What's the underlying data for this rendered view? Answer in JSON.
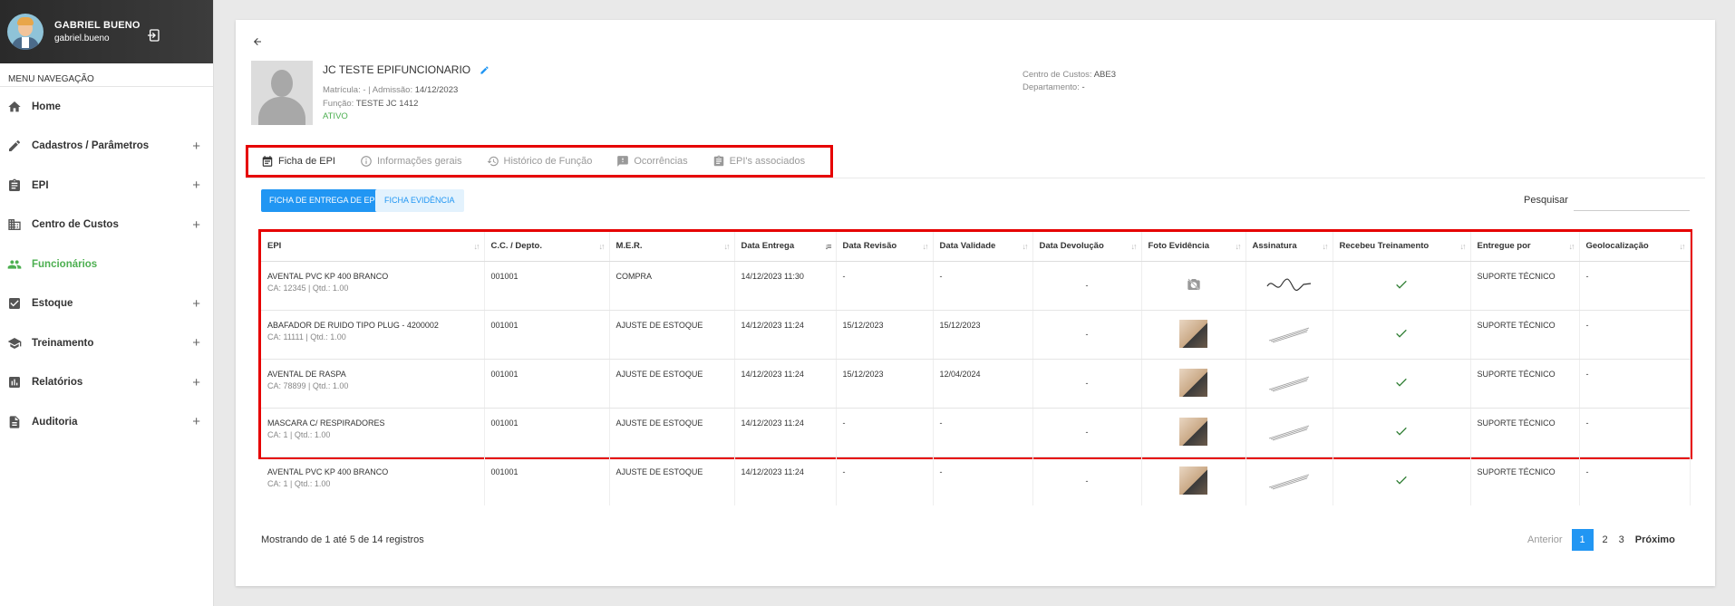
{
  "user": {
    "name": "GABRIEL BUENO",
    "login": "gabriel.bueno"
  },
  "menu": {
    "title": "MENU NAVEGAÇÃO",
    "items": [
      {
        "label": "Home",
        "icon": "home-icon",
        "expandable": false
      },
      {
        "label": "Cadastros / Parâmetros",
        "icon": "pencil-icon",
        "expandable": true
      },
      {
        "label": "EPI",
        "icon": "clipboard-icon",
        "expandable": true
      },
      {
        "label": "Centro de Custos",
        "icon": "building-icon",
        "expandable": true
      },
      {
        "label": "Funcionários",
        "icon": "people-icon",
        "expandable": false,
        "active": true
      },
      {
        "label": "Estoque",
        "icon": "checkbox-icon",
        "expandable": true
      },
      {
        "label": "Treinamento",
        "icon": "graduation-cap-icon",
        "expandable": true
      },
      {
        "label": "Relatórios",
        "icon": "bar-chart-icon",
        "expandable": true
      },
      {
        "label": "Auditoria",
        "icon": "document-icon",
        "expandable": true
      }
    ],
    "plus": "+"
  },
  "employee": {
    "name": "JC TESTE EPIFUNCIONARIO",
    "matricula_label": "Matrícula: - | Admissão:",
    "admissao": "14/12/2023",
    "funcao_label": "Função:",
    "funcao": "TESTE JC 1412",
    "status": "ATIVO",
    "centro_label": "Centro de Custos:",
    "centro": "ABE3",
    "departamento_label": "Departamento:",
    "departamento": "-"
  },
  "tabs": [
    {
      "label": "Ficha de EPI",
      "icon": "calendar-icon",
      "active": true
    },
    {
      "label": "Informações gerais",
      "icon": "info-icon"
    },
    {
      "label": "Histórico de Função",
      "icon": "history-icon"
    },
    {
      "label": "Ocorrências",
      "icon": "alert-icon"
    },
    {
      "label": "EPI's associados",
      "icon": "clipboard-icon"
    }
  ],
  "actions": {
    "primary": "FICHA DE ENTREGA DE EPI",
    "secondary": "FICHA EVIDÊNCIA"
  },
  "search": {
    "label": "Pesquisar",
    "value": ""
  },
  "table": {
    "columns": [
      "EPI",
      "C.C. / Depto.",
      "M.E.R.",
      "Data Entrega",
      "Data Revisão",
      "Data Validade",
      "Data Devolução",
      "Foto Evidência",
      "Assinatura",
      "Recebeu Treinamento",
      "Entregue por",
      "Geolocalização"
    ],
    "rows": [
      {
        "epi": "AVENTAL PVC KP 400 BRANCO",
        "sub": "CA: 12345 | Qtd.: 1.00",
        "cc": "001001",
        "mer": "COMPRA",
        "entrega": "14/12/2023 11:30",
        "revisao": "-",
        "validade": "-",
        "devolucao": "-",
        "foto": "no-image",
        "assinatura": "signature-scribble",
        "treinamento": "check",
        "entregue": "SUPORTE TÉCNICO",
        "geo": "-"
      },
      {
        "epi": "ABAFADOR DE RUIDO TIPO PLUG - 4200002",
        "sub": "CA: 11111 | Qtd.: 1.00",
        "cc": "001001",
        "mer": "AJUSTE DE ESTOQUE",
        "entrega": "14/12/2023 11:24",
        "revisao": "15/12/2023",
        "validade": "15/12/2023",
        "devolucao": "-",
        "foto": "photo",
        "assinatura": "signature-lines",
        "treinamento": "check",
        "entregue": "SUPORTE TÉCNICO",
        "geo": "-"
      },
      {
        "epi": "AVENTAL DE RASPA",
        "sub": "CA: 78899 | Qtd.: 1.00",
        "cc": "001001",
        "mer": "AJUSTE DE ESTOQUE",
        "entrega": "14/12/2023 11:24",
        "revisao": "15/12/2023",
        "validade": "12/04/2024",
        "devolucao": "-",
        "foto": "photo",
        "assinatura": "signature-lines",
        "treinamento": "check",
        "entregue": "SUPORTE TÉCNICO",
        "geo": "-"
      },
      {
        "epi": "MASCARA C/ RESPIRADORES",
        "sub": "CA: 1 | Qtd.: 1.00",
        "cc": "001001",
        "mer": "AJUSTE DE ESTOQUE",
        "entrega": "14/12/2023 11:24",
        "revisao": "-",
        "validade": "-",
        "devolucao": "-",
        "foto": "photo",
        "assinatura": "signature-lines",
        "treinamento": "check",
        "entregue": "SUPORTE TÉCNICO",
        "geo": "-"
      },
      {
        "epi": "AVENTAL PVC KP 400 BRANCO",
        "sub": "CA: 1 | Qtd.: 1.00",
        "cc": "001001",
        "mer": "AJUSTE DE ESTOQUE",
        "entrega": "14/12/2023 11:24",
        "revisao": "-",
        "validade": "-",
        "devolucao": "-",
        "foto": "photo",
        "assinatura": "signature-lines",
        "treinamento": "check",
        "entregue": "SUPORTE TÉCNICO",
        "geo": "-"
      }
    ]
  },
  "footer": {
    "info": "Mostrando de 1 até 5 de 14 registros",
    "prev": "Anterior",
    "pages": [
      "1",
      "2",
      "3"
    ],
    "current": "1",
    "next": "Próximo"
  },
  "colors": {
    "accent": "#2196f3",
    "active_menu": "#4caf50",
    "highlight_box": "#e60000"
  }
}
